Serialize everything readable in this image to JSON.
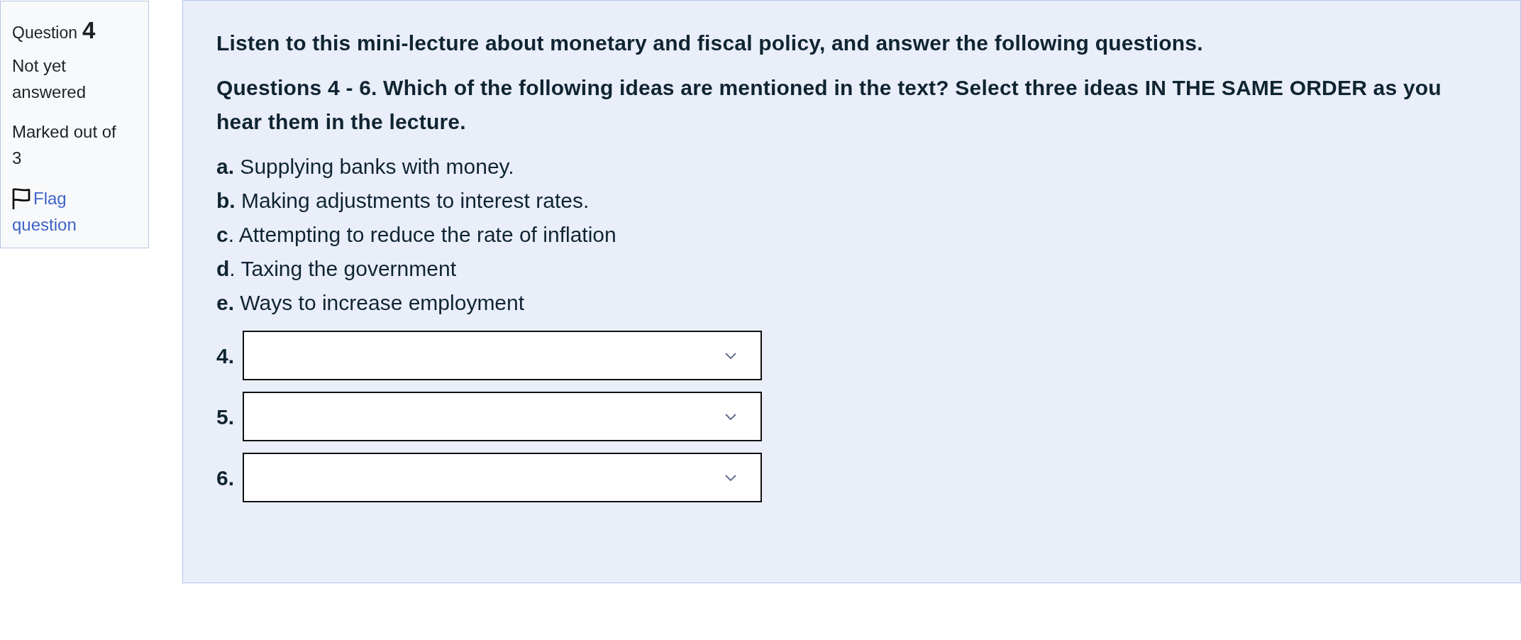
{
  "question_info": {
    "label": "Question",
    "number": "4",
    "status": "Not yet answered",
    "marks": "Marked out of 3",
    "flag_link": "Flag question",
    "flagged": false
  },
  "content": {
    "intro": "Listen to this mini-lecture about monetary and fiscal policy, and answer the following questions.",
    "prompt": "Questions 4 - 6. Which of the following ideas are mentioned in the text? Select three ideas IN THE SAME ORDER as you hear them in the lecture.",
    "options": [
      "**a.** Supplying banks with money.",
      "**b.** Making adjustments to interest rates.",
      "**c**. Attempting to reduce the rate of inflation",
      "**d**. Taxing the government",
      "**e.** Ways to increase employment"
    ],
    "answers": [
      {
        "label": "4."
      },
      {
        "label": "5."
      },
      {
        "label": "6."
      }
    ]
  }
}
